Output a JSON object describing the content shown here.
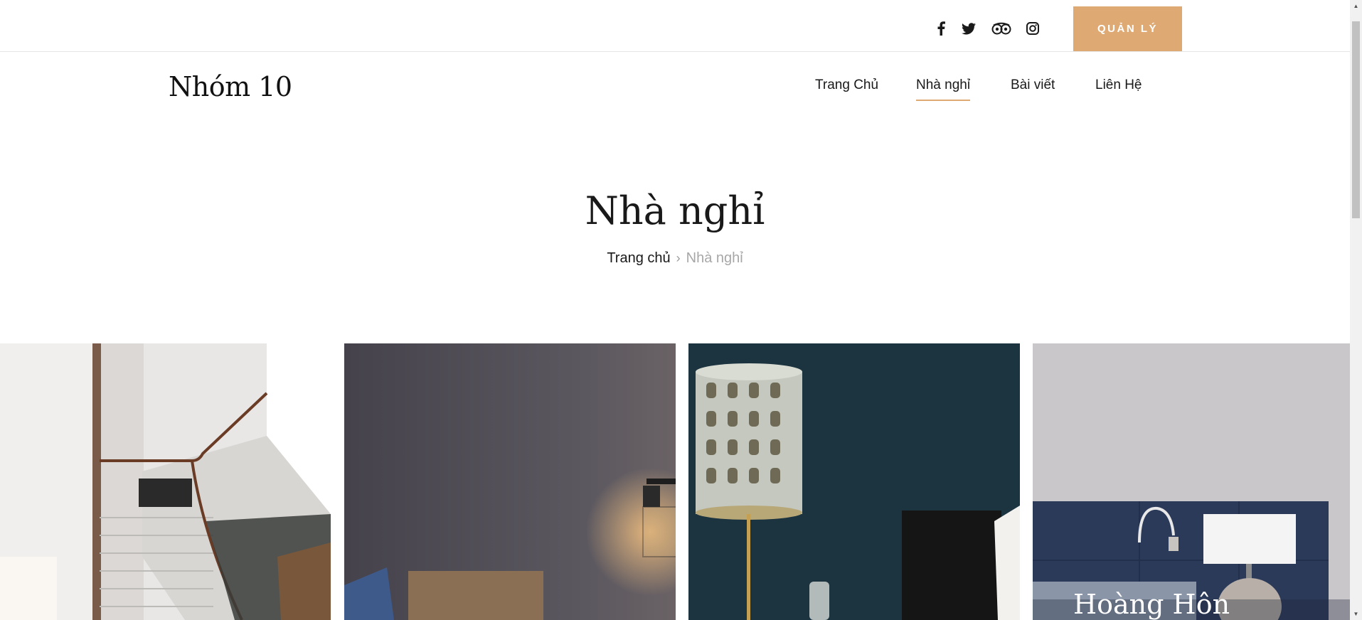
{
  "topbar": {
    "social_icons": [
      "facebook-icon",
      "twitter-icon",
      "tripadvisor-icon",
      "instagram-icon"
    ],
    "manage_button": "QUẢN LÝ"
  },
  "header": {
    "logo": "Nhóm 10",
    "nav": [
      {
        "label": "Trang Chủ",
        "active": false
      },
      {
        "label": "Nhà nghỉ",
        "active": true
      },
      {
        "label": "Bài viết",
        "active": false
      },
      {
        "label": "Liên Hệ",
        "active": false
      }
    ]
  },
  "hero": {
    "title": "Nhà nghỉ",
    "breadcrumb": {
      "home": "Trang chủ",
      "separator": "›",
      "current": "Nhà nghỉ"
    }
  },
  "rooms": [
    {
      "title": ""
    },
    {
      "title": ""
    },
    {
      "title": ""
    },
    {
      "title": "Hoàng Hôn"
    }
  ],
  "colors": {
    "accent": "#dfa974",
    "text": "#19191a"
  }
}
